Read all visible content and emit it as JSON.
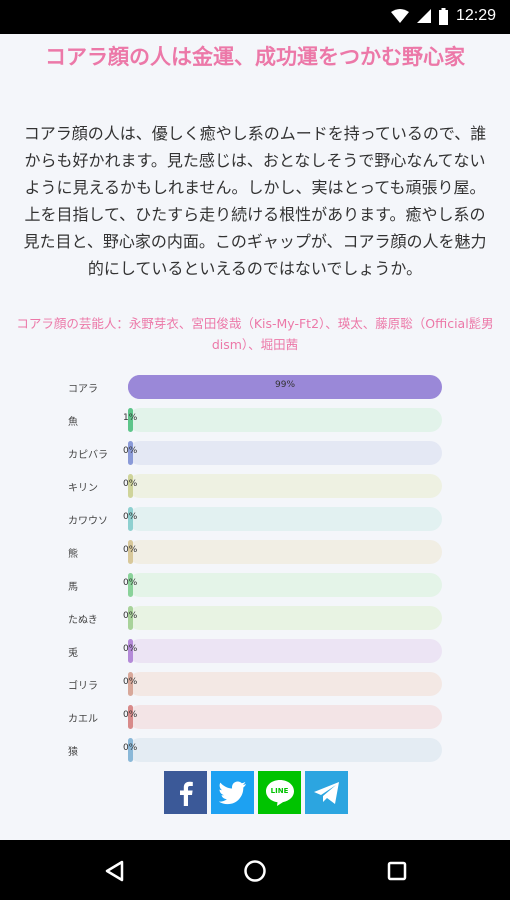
{
  "statusbar": {
    "time": "12:29"
  },
  "article": {
    "title": "コアラ顔の人は金運、成功運をつかむ野心家",
    "description": "コアラ顔の人は、優しく癒やし系のムードを持っているので、誰からも好かれます。見た感じは、おとなしそうで野心なんてないように見えるかもしれません。しかし、実はとっても頑張り屋。上を目指して、ひたすら走り続ける根性があります。癒やし系の見た目と、野心家の内面。このギャップが、コアラ顔の人を魅力的にしているといえるのではないでしょうか。",
    "celebrities": "コアラ顔の芸能人：永野芽衣、宮田俊哉（Kis-My-Ft2）、瑛太、藤原聡（Official髭男dism）、堀田茜"
  },
  "chart_data": {
    "type": "bar",
    "orientation": "horizontal",
    "categories": [
      "コアラ",
      "魚",
      "カピバラ",
      "キリン",
      "カワウソ",
      "熊",
      "馬",
      "たぬき",
      "兎",
      "ゴリラ",
      "カエル",
      "猿"
    ],
    "values": [
      99,
      1,
      0,
      0,
      0,
      0,
      0,
      0,
      0,
      0,
      0,
      0
    ],
    "value_labels": [
      "99%",
      "1%",
      "0%",
      "0%",
      "0%",
      "0%",
      "0%",
      "0%",
      "0%",
      "0%",
      "0%",
      "0%"
    ],
    "xlim": [
      0,
      100
    ],
    "colors": {
      "fill": [
        "#9a88d8",
        "#5dc58a",
        "#8a9ad8",
        "#cfd49a",
        "#8ed0d0",
        "#d8c89a",
        "#8ad29a",
        "#a8d29a",
        "#b48ad8",
        "#d8a89a",
        "#d88a8a",
        "#8ab8d8"
      ],
      "track": [
        "#9a88d8",
        "#e2f3ea",
        "#e4e8f4",
        "#eef1e2",
        "#e2f1f1",
        "#f1eee4",
        "#e4f4e8",
        "#e8f3e3",
        "#ece4f4",
        "#f3e8e4",
        "#f3e4e6",
        "#e4ecf3"
      ]
    }
  },
  "share": {
    "buttons": [
      {
        "name": "facebook",
        "color": "#3b5998"
      },
      {
        "name": "twitter",
        "color": "#1da1f2"
      },
      {
        "name": "line",
        "color": "#00c300",
        "text": "LINE"
      },
      {
        "name": "telegram",
        "color": "#2ca5e0"
      }
    ]
  }
}
